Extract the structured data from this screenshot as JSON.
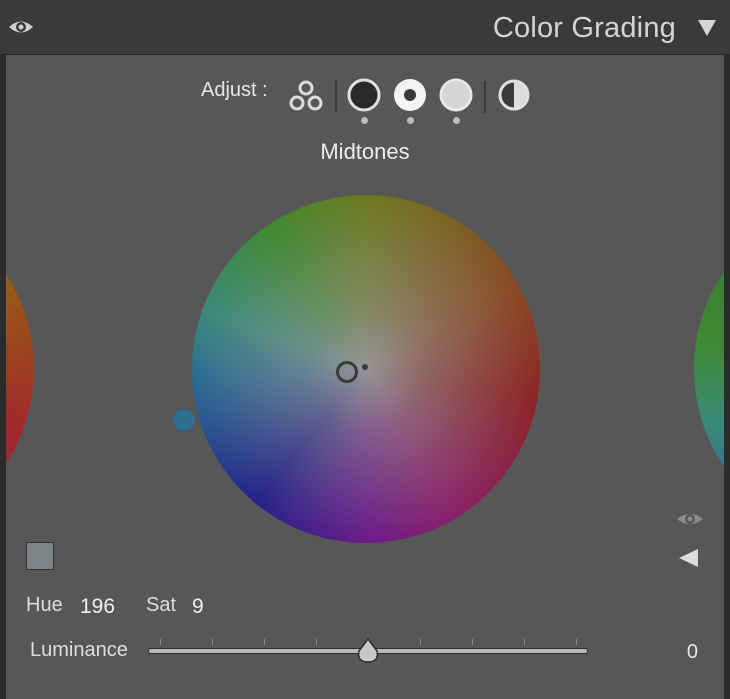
{
  "header": {
    "title": "Color Grading",
    "icons": [
      "eye-icon",
      "collapse-triangle-icon"
    ]
  },
  "adjust": {
    "label": "Adjust :",
    "modes": [
      {
        "name": "three-way",
        "icon": "three-circles-icon"
      },
      {
        "name": "shadows",
        "icon": "filled-circle-icon"
      },
      {
        "name": "midtones",
        "icon": "ring-circle-icon",
        "selected": true
      },
      {
        "name": "highlights",
        "icon": "light-circle-icon"
      },
      {
        "name": "global",
        "icon": "half-circle-icon"
      }
    ]
  },
  "region": {
    "label": "Midtones"
  },
  "fields": {
    "hue_label": "Hue",
    "hue_value": "196",
    "sat_label": "Sat",
    "sat_value": "9"
  },
  "luminance": {
    "label": "Luminance",
    "value": "0",
    "slider_fraction": 0.5
  },
  "colors": {
    "panel_bg": "#575757",
    "header_bg": "#3a3a3a",
    "swatch": "#7f868a",
    "sat_dot": "#2f6f8f"
  }
}
